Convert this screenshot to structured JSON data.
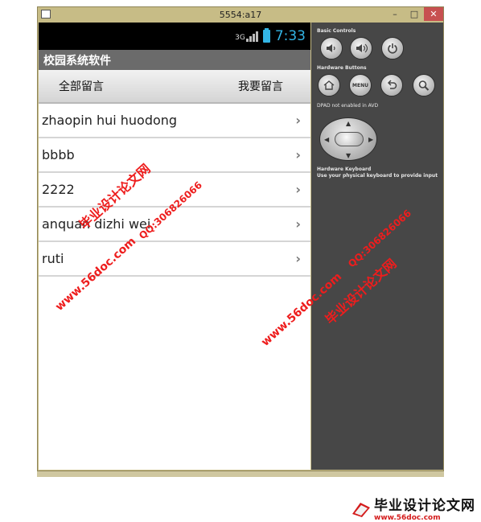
{
  "window": {
    "title": "5554:a17",
    "minimize": "–",
    "maximize": "□",
    "close": "✕"
  },
  "status_bar": {
    "network": "3G",
    "time": "7:33"
  },
  "app": {
    "title": "校园系统软件"
  },
  "tabs": {
    "all_messages": "全部留言",
    "my_message": "我要留言"
  },
  "list": [
    {
      "label": "zhaopin hui  huodong"
    },
    {
      "label": "bbbb"
    },
    {
      "label": "2222"
    },
    {
      "label": "anquan dizhi wei"
    },
    {
      "label": "ruti"
    }
  ],
  "chevron": "›",
  "controls": {
    "basic_label": "Basic Controls",
    "hardware_label": "Hardware Buttons",
    "menu_label": "MENU",
    "dpad_label": "DPAD not enabled in AVD",
    "keyboard_label": "Hardware Keyboard",
    "keyboard_note": "Use your physical keyboard to provide input"
  },
  "watermarks": {
    "site_name": "毕业设计论文网",
    "url": "www.56doc.com",
    "qq": "QQ:306826066"
  },
  "footer": {
    "brand": "毕业设计论文网",
    "url": "www.56doc.com"
  },
  "colors": {
    "frame": "#c7bc86",
    "panel": "#474747",
    "clock": "#33b5e5",
    "watermark": "#ee1d1d"
  }
}
